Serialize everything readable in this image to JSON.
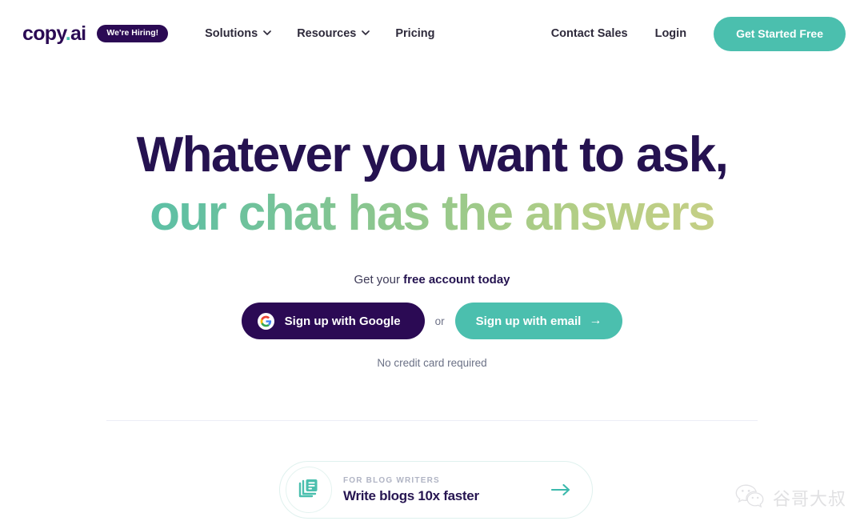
{
  "brand": {
    "accent_teal": "#4BBFAE",
    "dark_purple": "#2B0A54",
    "headline_navy": "#251250",
    "gradient_start": "#4ABFB2",
    "gradient_end": "#D8D086"
  },
  "navbar": {
    "logo_main": "copy",
    "logo_dot": ".",
    "logo_suffix": "ai",
    "hiring_badge": "We're Hiring!",
    "links": [
      {
        "label": "Solutions",
        "has_chevron": true,
        "icon": "chevron-down-icon"
      },
      {
        "label": "Resources",
        "has_chevron": true,
        "icon": "chevron-down-icon"
      },
      {
        "label": "Pricing",
        "has_chevron": false,
        "icon": ""
      }
    ],
    "contact_sales": "Contact Sales",
    "login": "Login",
    "get_started": "Get Started Free"
  },
  "hero": {
    "headline_line1": "Whatever you want to ask,",
    "headline_line2": "our chat has the answers",
    "subline_prefix": "Get your ",
    "subline_bold": "free account today",
    "google_button": "Sign up with Google",
    "google_icon": "google-g-icon",
    "or_text": "or",
    "email_button": "Sign up with email",
    "email_arrow": "→",
    "no_credit_card": "No credit card required"
  },
  "feature_card": {
    "icon": "documents-stack-icon",
    "eyebrow": "FOR BLOG WRITERS",
    "title": "Write blogs 10x faster",
    "arrow_icon": "arrow-right-icon"
  },
  "watermark": {
    "icon": "wechat-icon",
    "text": "谷哥大叔"
  }
}
